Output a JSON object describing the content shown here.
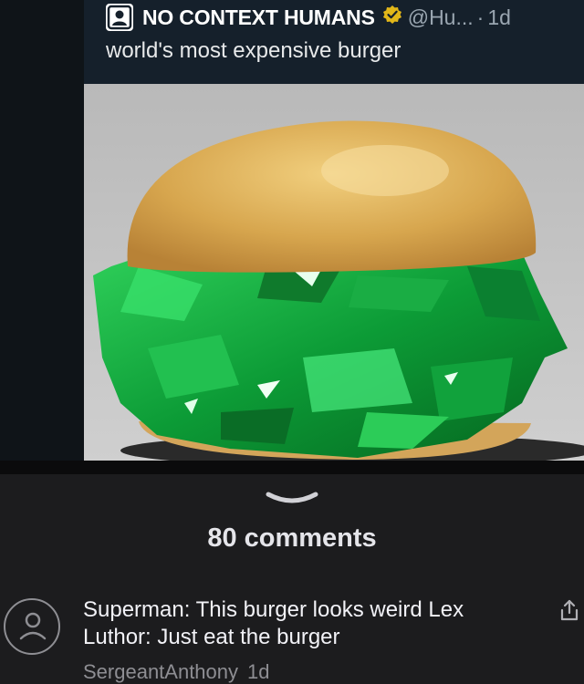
{
  "tweet": {
    "account_name": "NO CONTEXT HUMANS",
    "handle": "@Hu...",
    "separator": "·",
    "time": "1d",
    "text": "world's most expensive burger",
    "icons": {
      "avatar": "person-silhouette-icon",
      "verified": "verified-badge-icon"
    },
    "colors": {
      "verified": "#e2b719",
      "card_bg": "#15202b"
    }
  },
  "photo": {
    "subject": "burger-with-emerald-gemstones"
  },
  "comments_section": {
    "collapse_icon": "chevron-down-icon",
    "count_label": "80 comments"
  },
  "comment": {
    "text": "Superman: This burger looks weird Lex Luthor: Just eat the burger",
    "author": "SergeantAnthony",
    "time": "1d",
    "icons": {
      "avatar": "user-avatar-icon",
      "share": "share-icon"
    }
  }
}
